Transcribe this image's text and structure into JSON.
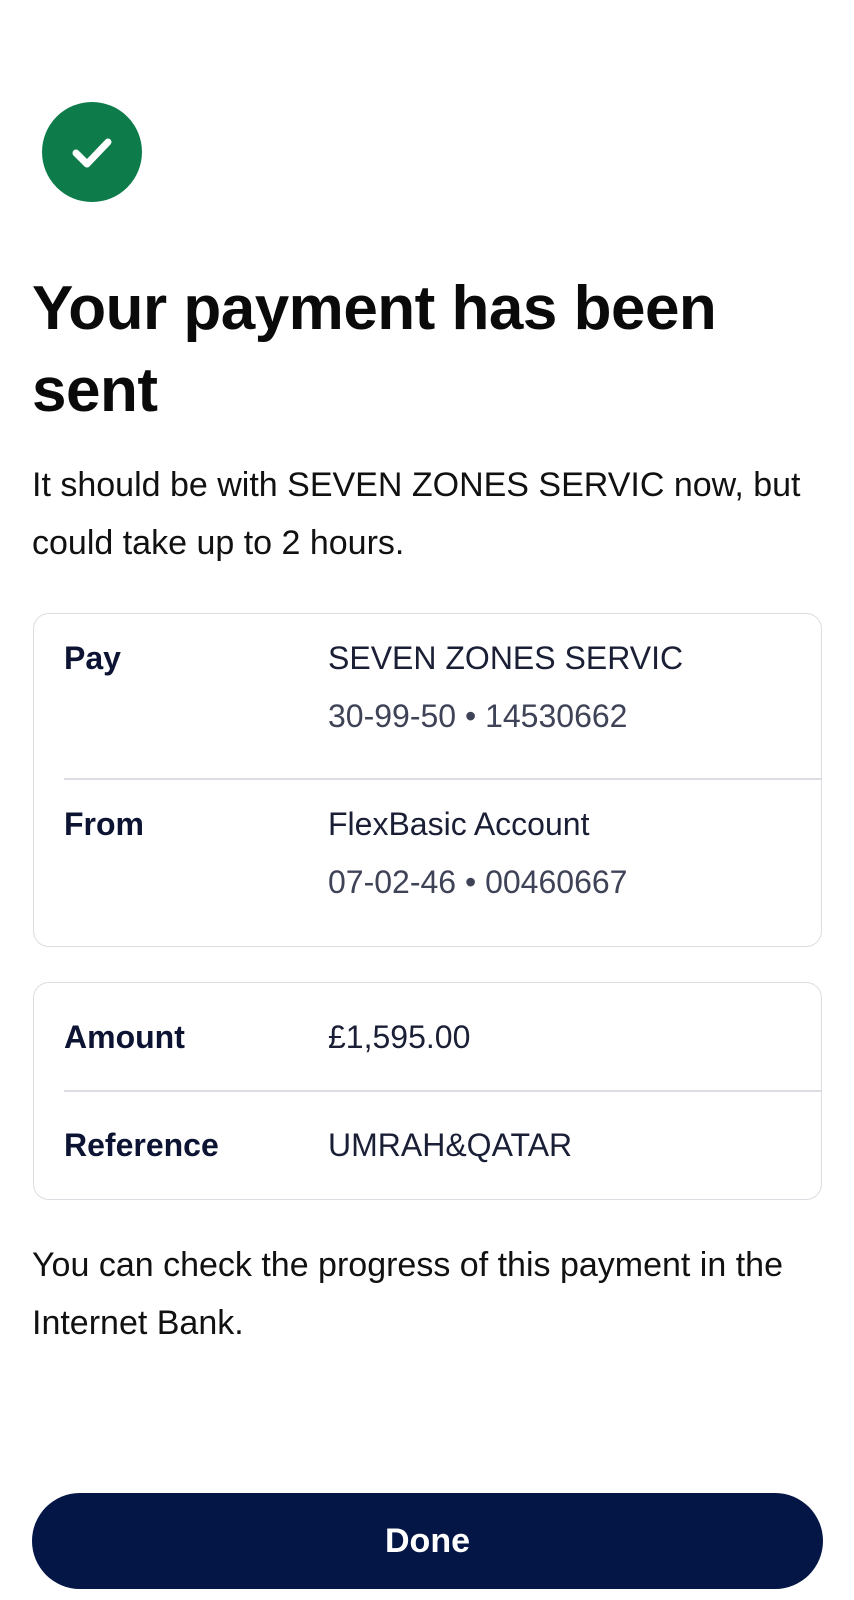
{
  "status": {
    "icon": "checkmark-circle-icon",
    "color": "#0e7c4a"
  },
  "title": "Your payment has been sent",
  "subtitle": "It should be with SEVEN ZONES SERVIC now, but could take up to 2 hours.",
  "accounts": {
    "pay": {
      "label": "Pay",
      "name": "SEVEN ZONES SERVIC",
      "details": "30-99-50 • 14530662"
    },
    "from": {
      "label": "From",
      "name": "FlexBasic Account",
      "details": "07-02-46 • 00460667"
    }
  },
  "details": {
    "amount": {
      "label": "Amount",
      "value": "£1,595.00"
    },
    "reference": {
      "label": "Reference",
      "value": "UMRAH&QATAR"
    }
  },
  "footer_text": "You can check the progress of this payment in the Internet Bank.",
  "done_button": {
    "label": "Done",
    "color": "#041646"
  }
}
